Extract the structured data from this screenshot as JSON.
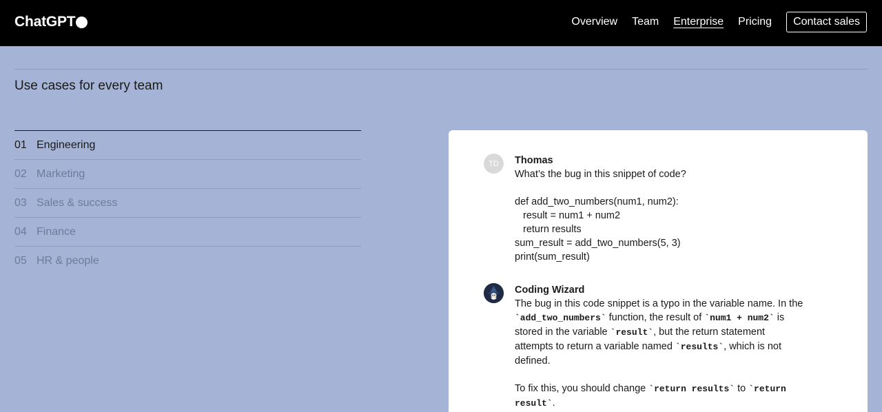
{
  "header": {
    "logo": "ChatGPT",
    "nav": [
      {
        "label": "Overview",
        "active": false
      },
      {
        "label": "Team",
        "active": false
      },
      {
        "label": "Enterprise",
        "active": true
      },
      {
        "label": "Pricing",
        "active": false
      }
    ],
    "contact_label": "Contact sales"
  },
  "section": {
    "title": "Use cases for every team"
  },
  "usecases": [
    {
      "num": "01",
      "label": "Engineering",
      "active": true
    },
    {
      "num": "02",
      "label": "Marketing",
      "active": false
    },
    {
      "num": "03",
      "label": "Sales & success",
      "active": false
    },
    {
      "num": "04",
      "label": "Finance",
      "active": false
    },
    {
      "num": "05",
      "label": "HR & people",
      "active": false
    }
  ],
  "chat": {
    "user": {
      "initials": "TD",
      "name": "Thomas",
      "question": "What’s the bug in this snippet of code?",
      "code": [
        "def add_two_numbers(num1, num2):",
        "result = num1 + num2",
        "return results",
        "sum_result = add_two_numbers(5, 3)",
        "print(sum_result)"
      ]
    },
    "bot": {
      "name": "Coding Wizard",
      "p1_a": "The bug in this code snippet is a typo in the variable name. In the ",
      "p1_code1": "`add_two_numbers`",
      "p1_b": " function, the result of ",
      "p1_code2": "`num1 + num2`",
      "p1_c": " is stored in the variable ",
      "p1_code3": "`result`",
      "p1_d": ", but the return statement attempts to return a variable named ",
      "p1_code4": "`results`",
      "p1_e": ", which is not defined.",
      "p2_a": "To fix this, you should change ",
      "p2_code1": "`return results`",
      "p2_b": " to ",
      "p2_code2": "`return result`",
      "p2_c": "."
    }
  }
}
